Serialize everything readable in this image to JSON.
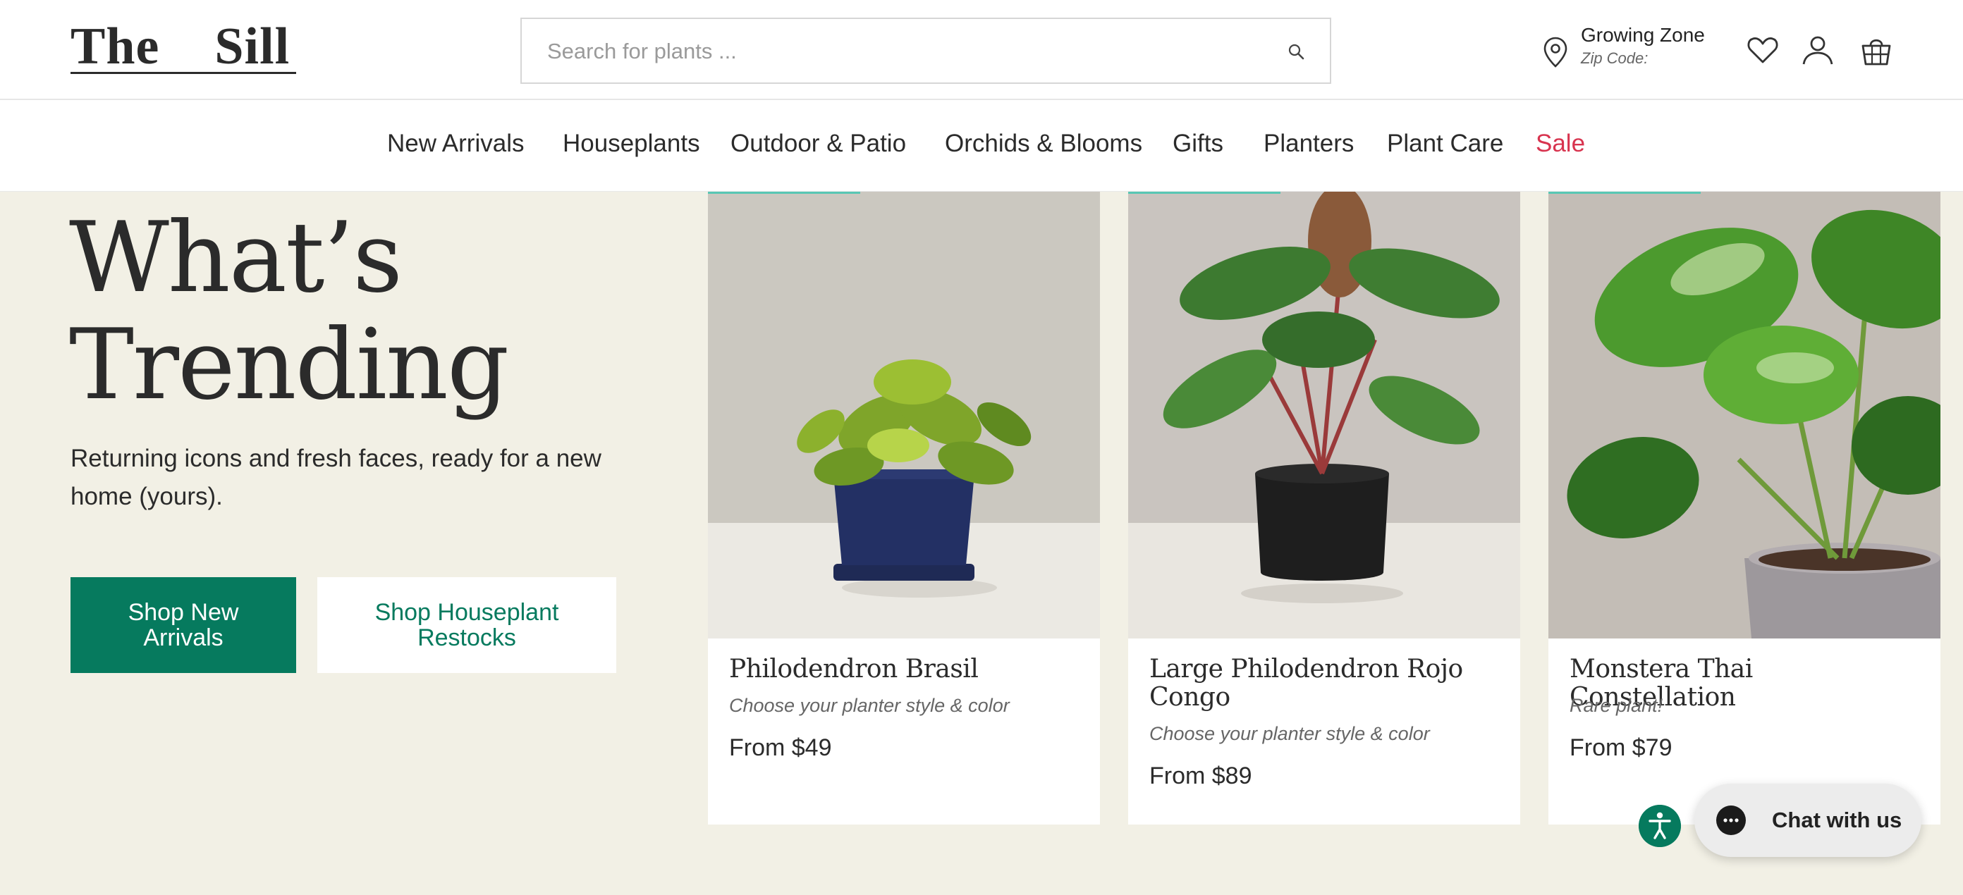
{
  "header": {
    "logo_left": "The",
    "logo_right": "Sill",
    "search_placeholder": "Search for plants ...",
    "zone_title": "Growing Zone",
    "zone_sub": "Zip Code:"
  },
  "nav": {
    "items": [
      "New Arrivals",
      "Houseplants",
      "Outdoor & Patio",
      "Orchids & Blooms",
      "Gifts",
      "Planters",
      "Plant Care",
      "Sale"
    ]
  },
  "hero": {
    "title_line1": "What’s",
    "title_line2": "Trending",
    "subtitle": "Returning icons and fresh faces, ready for a new home (yours).",
    "primary_button": "Shop New Arrivals",
    "secondary_button": "Shop Houseplant Restocks"
  },
  "products": [
    {
      "name": "Philodendron Brasil",
      "note": "Choose your planter style & color",
      "price": "From $49"
    },
    {
      "name": "Large Philodendron Rojo Congo",
      "note": "Choose your planter style & color",
      "price": "From $89"
    },
    {
      "name": "Monstera Thai Constellation",
      "note": "Rare plant!",
      "price": "From $79"
    }
  ],
  "chat": {
    "label": "Chat with us"
  },
  "colors": {
    "brand_green": "#067a5e",
    "sale_red": "#d8344f",
    "hero_bg": "#f2f0e5",
    "accent_teal": "#58c7b4"
  },
  "icons": [
    "search-icon",
    "location-pin-icon",
    "heart-icon",
    "user-icon",
    "cart-icon",
    "accessibility-icon",
    "chat-bubble-icon"
  ]
}
